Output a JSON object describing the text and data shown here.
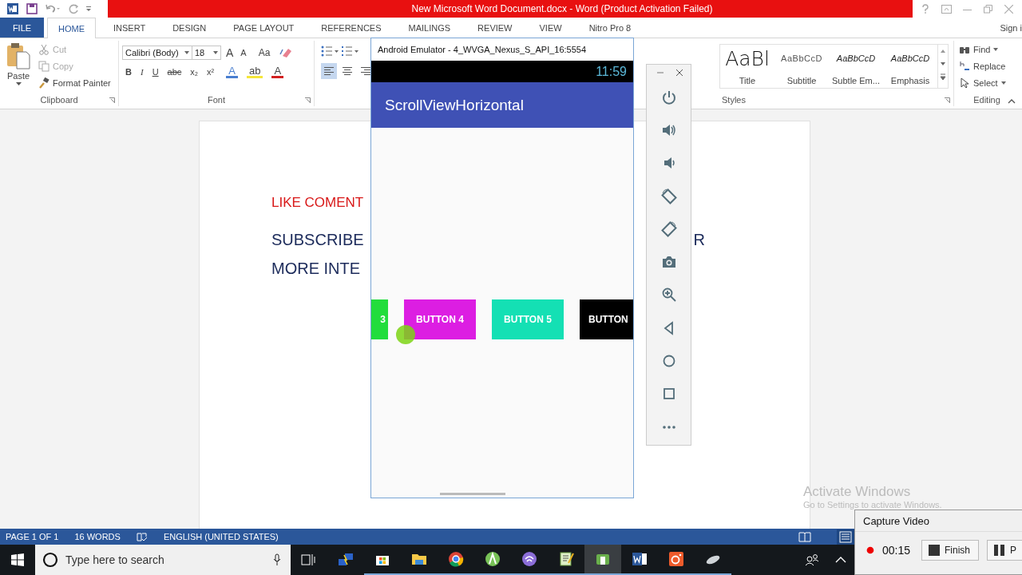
{
  "word": {
    "title": "New Microsoft Word Document.docx -  Word (Product Activation Failed)",
    "tabs": [
      {
        "label": "FILE",
        "kind": "file",
        "selected": false
      },
      {
        "label": "HOME",
        "kind": "tab",
        "selected": true
      },
      {
        "label": "INSERT",
        "kind": "tab",
        "selected": false
      },
      {
        "label": "DESIGN",
        "kind": "tab",
        "selected": false
      },
      {
        "label": "PAGE LAYOUT",
        "kind": "tab",
        "selected": false
      },
      {
        "label": "REFERENCES",
        "kind": "tab",
        "selected": false
      },
      {
        "label": "MAILINGS",
        "kind": "tab",
        "selected": false
      },
      {
        "label": "REVIEW",
        "kind": "tab",
        "selected": false
      },
      {
        "label": "VIEW",
        "kind": "tab",
        "selected": false
      },
      {
        "label": "Nitro Pro 8",
        "kind": "tab",
        "selected": false
      }
    ],
    "sign_in": "Sign i",
    "clipboard": {
      "paste": "Paste",
      "items": [
        {
          "label": "Cut",
          "kind": "cut",
          "disabled": true
        },
        {
          "label": "Copy",
          "kind": "copy",
          "disabled": true
        },
        {
          "label": "Format Painter",
          "kind": "painter",
          "disabled": false
        }
      ],
      "label": "Clipboard"
    },
    "font": {
      "family": "Calibri (Body)",
      "size": "18",
      "size_buttons": [
        {
          "glyph": "A",
          "kind": "grow-font"
        },
        {
          "glyph": "A",
          "kind": "shrink-font"
        }
      ],
      "change_case": "Aa",
      "format_buttons": [
        {
          "glyph": "B",
          "kind": "bold"
        },
        {
          "glyph": "I",
          "kind": "italic"
        },
        {
          "glyph": "U",
          "kind": "underline"
        },
        {
          "glyph": "abc",
          "kind": "strikethrough"
        },
        {
          "glyph": "x₂",
          "kind": "subscript"
        },
        {
          "glyph": "x²",
          "kind": "superscript"
        }
      ],
      "color_buttons": [
        {
          "glyph": "A",
          "kind": "text-effects"
        },
        {
          "glyph": "ab",
          "kind": "highlight"
        },
        {
          "glyph": "A",
          "kind": "font-color"
        }
      ],
      "label": "Font"
    },
    "paragraph": {
      "alignment": [
        {
          "kind": "left",
          "selected": true
        },
        {
          "kind": "center",
          "selected": false
        },
        {
          "kind": "right",
          "selected": false
        }
      ]
    },
    "styles": {
      "previews": [
        {
          "sample": "AaBl",
          "name": "Title",
          "kind": "title"
        },
        {
          "sample": "AaBbCcD",
          "name": "Subtitle",
          "kind": "subtitle"
        },
        {
          "sample": "AaBbCcD",
          "name": "Subtle Em...",
          "kind": "italic"
        },
        {
          "sample": "AaBbCcD",
          "name": "Emphasis",
          "kind": "italic"
        }
      ],
      "label": "Styles"
    },
    "editing": {
      "items": [
        {
          "label": "Find",
          "kind": "find"
        },
        {
          "label": "Replace",
          "kind": "replace"
        },
        {
          "label": "Select",
          "kind": "select"
        }
      ],
      "label": "Editing"
    },
    "document": {
      "lines": [
        {
          "kind": "accent",
          "text": "LIKE COMENT"
        },
        {
          "kind": "body",
          "text": "SUBSCRIBE",
          "tail": "R"
        },
        {
          "kind": "body",
          "text": "MORE INTE"
        }
      ]
    },
    "status_bar": {
      "page": "PAGE 1 OF 1",
      "words": "16 WORDS",
      "language": "ENGLISH (UNITED STATES)"
    }
  },
  "emulator": {
    "title": "Android Emulator - 4_WVGA_Nexus_S_API_16:5554",
    "time": "11:59",
    "app_title": "ScrollViewHorizontal",
    "buttons": [
      {
        "label": "3",
        "color": "#22dd3c"
      },
      {
        "label": "BUTTON 4",
        "color": "#dc1ee2"
      },
      {
        "label": "BUTTON 5",
        "color": "#14e0b4"
      },
      {
        "label": "BUTTON",
        "color": "#000000"
      }
    ]
  },
  "activation": {
    "title": "Activate Windows",
    "hint": "Go to Settings to activate Windows."
  },
  "taskbar": {
    "search": {
      "placeholder": "Type here to search"
    }
  },
  "capture": {
    "title": "Capture Video",
    "time": "00:15",
    "buttons": [
      {
        "label": "Finish",
        "kind": "finish"
      },
      {
        "label": "P",
        "kind": "pause"
      }
    ]
  }
}
